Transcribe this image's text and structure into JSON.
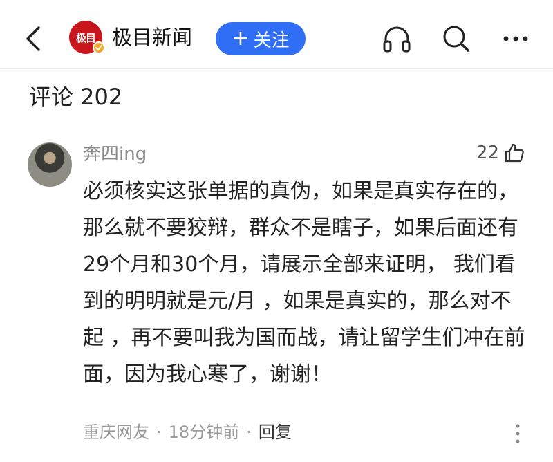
{
  "header": {
    "logo_text": "极目",
    "source_name": "极目新闻",
    "follow_label": "关注",
    "follow_plus": "+",
    "icons": [
      "back-icon",
      "headphones-icon",
      "search-icon",
      "more-icon"
    ]
  },
  "comments_section": {
    "title": "评论 202"
  },
  "comment": {
    "username": "奔四ing",
    "like_count": "22",
    "text": "必须核实这张单据的真伪，如果是真实存在的，那么就不要狡辩，群众不是瞎子，如果后面还有29个月和30个月，请展示全部来证明， 我们看到的明明就是元/月 ，如果是真实的，那么对不起 ，再不要叫我为国而战，请让留学生们冲在前面，因为我心寒了，谢谢！",
    "location": "重庆网友",
    "time": "18分钟前",
    "reply_label": "回复",
    "separator": "·"
  },
  "colors": {
    "accent": "#2f6ef5",
    "logo": "#c9161d",
    "verified": "#f5a623"
  }
}
